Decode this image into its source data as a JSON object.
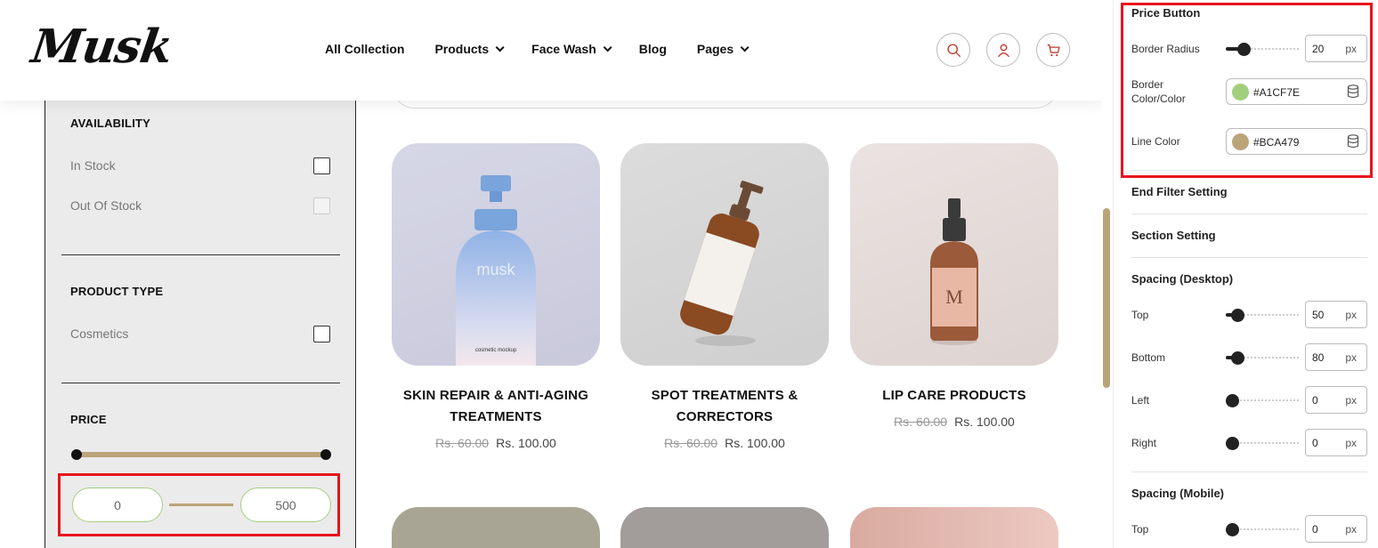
{
  "brand": {
    "logo_text": "Musk"
  },
  "nav": {
    "items": [
      {
        "label": "All Collection",
        "has_dropdown": false
      },
      {
        "label": "Products",
        "has_dropdown": true
      },
      {
        "label": "Face Wash",
        "has_dropdown": true
      },
      {
        "label": "Blog",
        "has_dropdown": false
      },
      {
        "label": "Pages",
        "has_dropdown": true
      }
    ],
    "icons": [
      "search-icon",
      "user-icon",
      "cart-icon"
    ]
  },
  "filters": {
    "availability": {
      "heading": "AVAILABILITY",
      "options": [
        {
          "label": "In Stock",
          "enabled": true
        },
        {
          "label": "Out Of Stock",
          "enabled": false
        }
      ]
    },
    "product_type": {
      "heading": "PRODUCT TYPE",
      "options": [
        {
          "label": "Cosmetics",
          "enabled": true
        }
      ]
    },
    "price": {
      "heading": "PRICE",
      "min": "0",
      "max": "500"
    }
  },
  "products": [
    {
      "title_line1": "SKIN REPAIR & ANTI-AGING",
      "title_line2": "TREATMENTS",
      "old_price": "Rs. 60.00",
      "price": "Rs. 100.00"
    },
    {
      "title_line1": "SPOT TREATMENTS &",
      "title_line2": "CORRECTORS",
      "old_price": "Rs. 60.00",
      "price": "Rs. 100.00"
    },
    {
      "title_line1": "LIP CARE PRODUCTS",
      "title_line2": "",
      "old_price": "Rs. 60.00",
      "price": "Rs. 100.00"
    }
  ],
  "bottle_texts": {
    "musk": "musk",
    "mockup": "cosmetic mockup",
    "m": "M"
  },
  "panel": {
    "price_button": {
      "title": "Price Button",
      "border_radius_label": "Border Radius",
      "border_radius_value": "20",
      "unit": "px",
      "border_color_label_1": "Border",
      "border_color_label_2": "Color/Color",
      "border_color": "#A1CF7E",
      "line_color_label": "Line Color",
      "line_color": "#BCA479"
    },
    "end_filter_setting": "End Filter Setting",
    "section_setting": "Section Setting",
    "spacing_desktop": {
      "title": "Spacing (Desktop)",
      "top_label": "Top",
      "top": "50",
      "bottom_label": "Bottom",
      "bottom": "80",
      "left_label": "Left",
      "left": "0",
      "right_label": "Right",
      "right": "0"
    },
    "spacing_mobile": {
      "title": "Spacing (Mobile)",
      "top_label": "Top",
      "top": "0"
    }
  },
  "colors": {
    "accent_border": "#A1CF7E",
    "accent_line": "#BCA479",
    "highlight": "#e8141c",
    "icon_red": "#c0392b"
  }
}
